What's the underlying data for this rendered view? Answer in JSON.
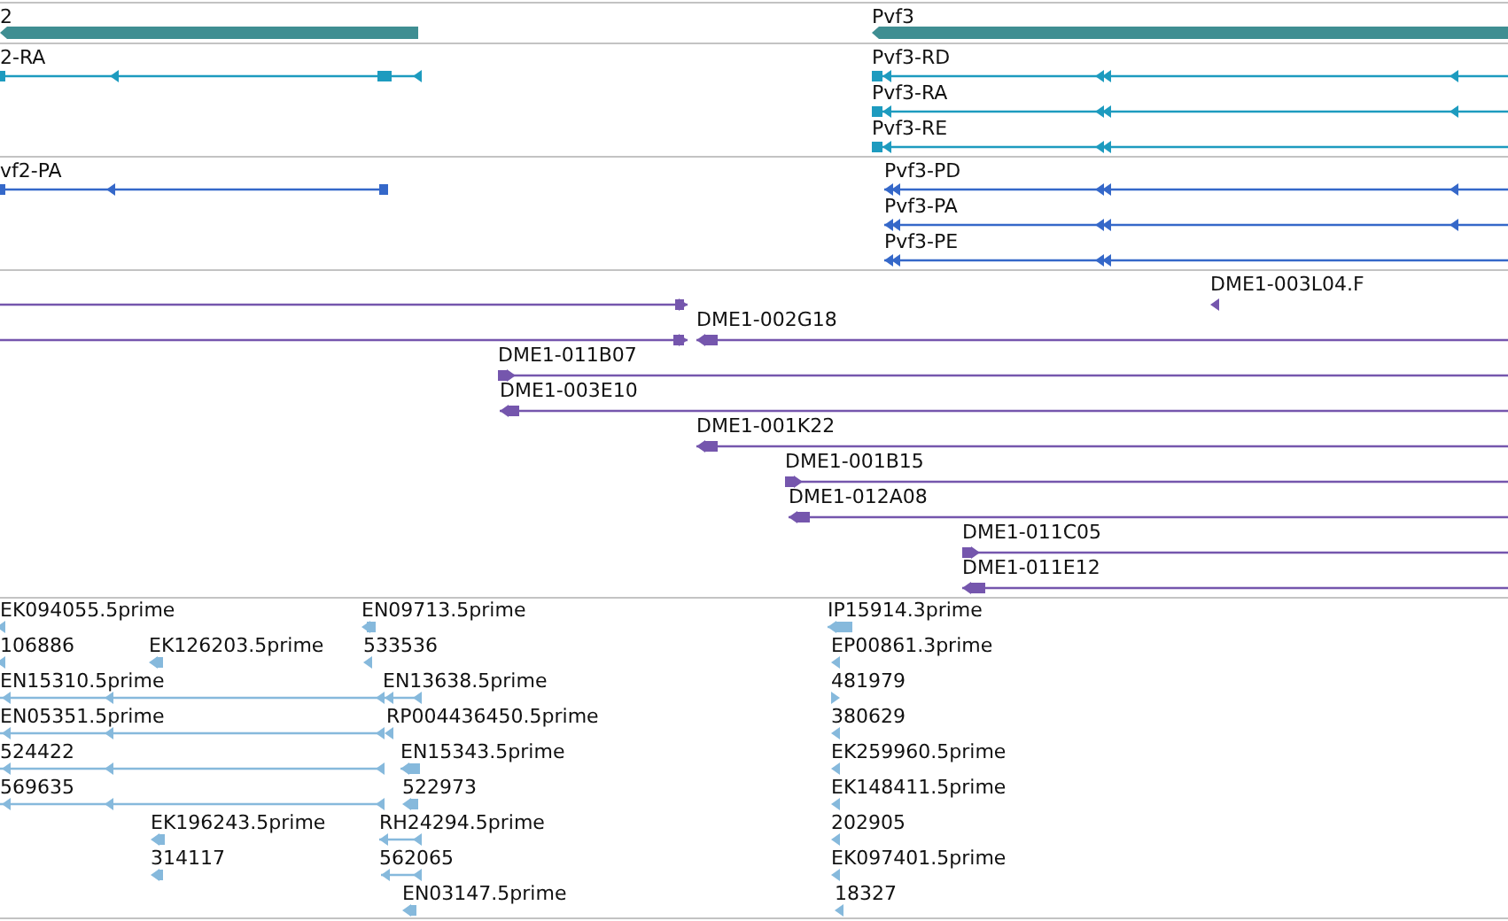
{
  "tracks": [
    {
      "kind": "gene",
      "color": "#3f8e92",
      "features": [
        {
          "label": "2",
          "reverse": true
        },
        {
          "label": "Pvf3",
          "reverse": true
        }
      ]
    },
    {
      "kind": "transcript",
      "color": "#1d9bbf",
      "features": [
        {
          "label": "2-RA",
          "reverse": true
        },
        {
          "label": "Pvf3-RD",
          "reverse": true
        },
        {
          "label": "Pvf3-RA",
          "reverse": true
        },
        {
          "label": "Pvf3-RE",
          "reverse": true
        }
      ]
    },
    {
      "kind": "protein",
      "color": "#3568c9",
      "features": [
        {
          "label": "vf2-PA",
          "reverse": true
        },
        {
          "label": "Pvf3-PD",
          "reverse": true
        },
        {
          "label": "Pvf3-PA",
          "reverse": true
        },
        {
          "label": "Pvf3-PE",
          "reverse": true
        }
      ]
    },
    {
      "kind": "clone",
      "color": "#7556ad",
      "features": [
        {
          "reverse": false
        },
        {
          "label": "DME1-003L04.F",
          "reverse": true
        },
        {
          "reverse": false
        },
        {
          "label": "DME1-002G18",
          "reverse": true
        },
        {
          "label": "DME1-011B07",
          "reverse": false
        },
        {
          "label": "DME1-003E10",
          "reverse": true
        },
        {
          "label": "DME1-001K22",
          "reverse": true
        },
        {
          "label": "DME1-001B15",
          "reverse": false
        },
        {
          "label": "DME1-012A08",
          "reverse": true
        },
        {
          "label": "DME1-011C05",
          "reverse": false
        },
        {
          "label": "DME1-011E12",
          "reverse": true
        }
      ]
    },
    {
      "kind": "est",
      "color": "#86b9dc",
      "features": [
        {
          "label": "EK094055.5prime",
          "reverse": true
        },
        {
          "label": "EN09713.5prime",
          "reverse": true
        },
        {
          "label": "IP15914.3prime",
          "reverse": true
        },
        {
          "label": "106886",
          "reverse": true
        },
        {
          "label": "EK126203.5prime",
          "reverse": true
        },
        {
          "label": "533536",
          "reverse": true
        },
        {
          "label": "EP00861.3prime",
          "reverse": true
        },
        {
          "label": "EN15310.5prime",
          "reverse": true
        },
        {
          "label": "EN13638.5prime",
          "reverse": true
        },
        {
          "label": "481979",
          "reverse": false
        },
        {
          "label": "EN05351.5prime",
          "reverse": true
        },
        {
          "label": "RP004436450.5prime",
          "reverse": true
        },
        {
          "label": "380629",
          "reverse": true
        },
        {
          "label": "524422",
          "reverse": true
        },
        {
          "label": "EN15343.5prime",
          "reverse": true
        },
        {
          "label": "EK259960.5prime",
          "reverse": true
        },
        {
          "label": "569635",
          "reverse": true
        },
        {
          "label": "522973",
          "reverse": true
        },
        {
          "label": "EK148411.5prime",
          "reverse": true
        },
        {
          "label": "EK196243.5prime",
          "reverse": true
        },
        {
          "label": "RH24294.5prime",
          "reverse": true
        },
        {
          "label": "202905",
          "reverse": true
        },
        {
          "label": "314117",
          "reverse": true
        },
        {
          "label": "562065",
          "reverse": true
        },
        {
          "label": "EK097401.5prime",
          "reverse": true
        },
        {
          "label": "EN03147.5prime",
          "reverse": true
        },
        {
          "label": "18327",
          "reverse": true
        }
      ]
    }
  ]
}
